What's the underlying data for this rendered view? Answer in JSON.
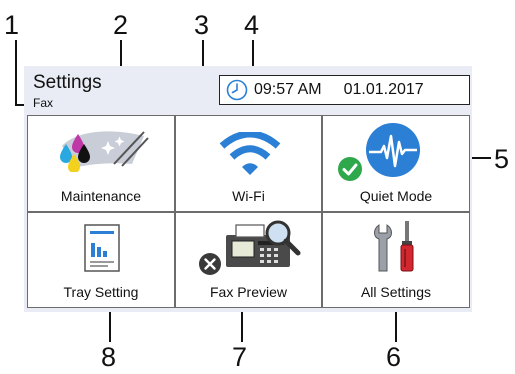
{
  "callouts": [
    "1",
    "2",
    "3",
    "4",
    "5",
    "6",
    "7",
    "8"
  ],
  "header": {
    "title": "Settings",
    "subtitle": "Fax"
  },
  "datetime": {
    "time": "09:57 AM",
    "date": "01.01.2017"
  },
  "tiles": [
    {
      "label": "Maintenance",
      "icon": "ink-cartridges-icon"
    },
    {
      "label": "Wi-Fi",
      "icon": "wifi-icon"
    },
    {
      "label": "Quiet Mode",
      "icon": "quiet-mode-icon",
      "status": "on"
    },
    {
      "label": "Tray Setting",
      "icon": "tray-document-icon"
    },
    {
      "label": "Fax Preview",
      "icon": "fax-preview-icon",
      "status": "off"
    },
    {
      "label": "All Settings",
      "icon": "tools-icon"
    }
  ],
  "colors": {
    "screen_bg": "#e9ecf5",
    "accent_blue": "#2b7fd4",
    "status_on": "#2ea84a",
    "status_off": "#3a3a3a"
  }
}
